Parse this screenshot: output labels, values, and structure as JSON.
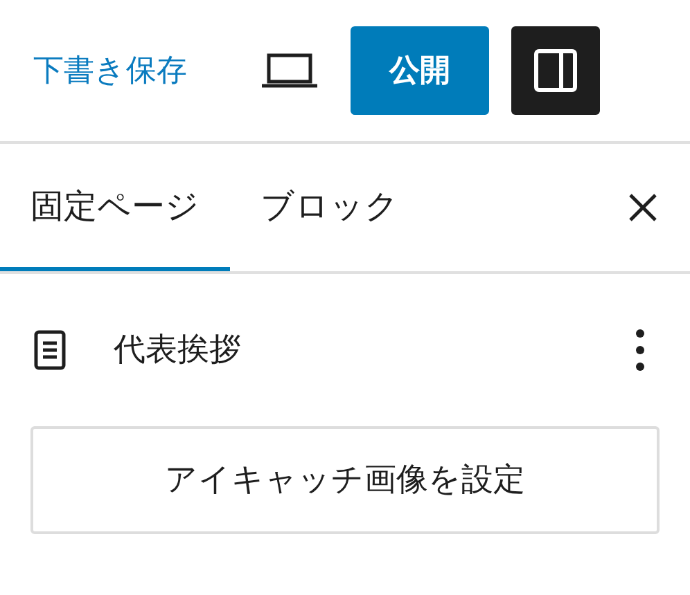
{
  "header": {
    "save_draft": "下書き保存",
    "publish": "公開",
    "sidebar_toggle": {
      "selected": true
    }
  },
  "tabs": [
    {
      "label": "固定ページ",
      "selected": true
    },
    {
      "label": "ブロック",
      "selected": false
    }
  ],
  "page": {
    "title": "代表挨拶"
  },
  "featured_image_button": "アイキャッチ画像を設定"
}
